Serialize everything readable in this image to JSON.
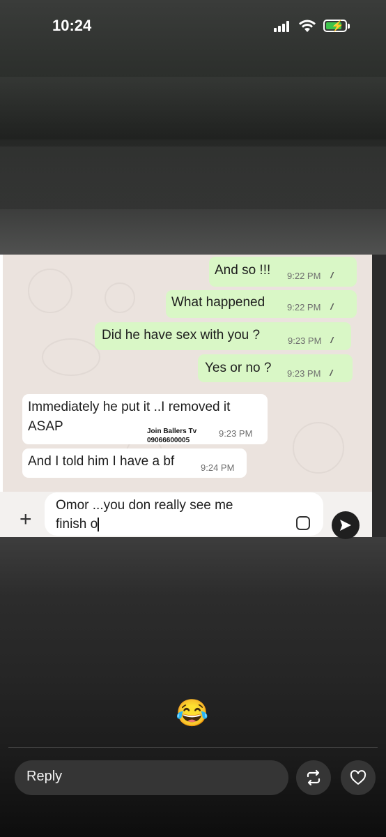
{
  "status_bar": {
    "time": "10:24"
  },
  "chat": {
    "outgoing": [
      {
        "text": "And so !!!",
        "time": "9:22 PM",
        "ticks": "//"
      },
      {
        "text": "What happened",
        "time": "9:22 PM",
        "ticks": "//"
      },
      {
        "text": "Did he have sex with you ?",
        "time": "9:23 PM",
        "ticks": "//"
      },
      {
        "text": "Yes or no ?",
        "time": "9:23 PM",
        "ticks": "//"
      }
    ],
    "incoming": [
      {
        "line1": "Immediately he put it ..I removed it",
        "line2": "ASAP",
        "time": "9:23 PM"
      },
      {
        "text": "And I told him I have a bf",
        "time": "9:24 PM"
      }
    ],
    "watermark": {
      "line1": "Join Ballers Tv",
      "line2": "09066600005"
    },
    "composer": {
      "line1": "Omor ...you don really see me",
      "line2": "finish o"
    }
  },
  "reaction_emoji": "😂",
  "reply_bar": {
    "placeholder": "Reply"
  },
  "icons": {
    "signal": "cellular-signal-icon",
    "wifi": "wifi-icon",
    "battery": "battery-charging-icon",
    "repost": "repost-icon",
    "like": "heart-icon",
    "send": "send-icon",
    "plus": "plus-icon",
    "sticker": "sticker-icon"
  }
}
